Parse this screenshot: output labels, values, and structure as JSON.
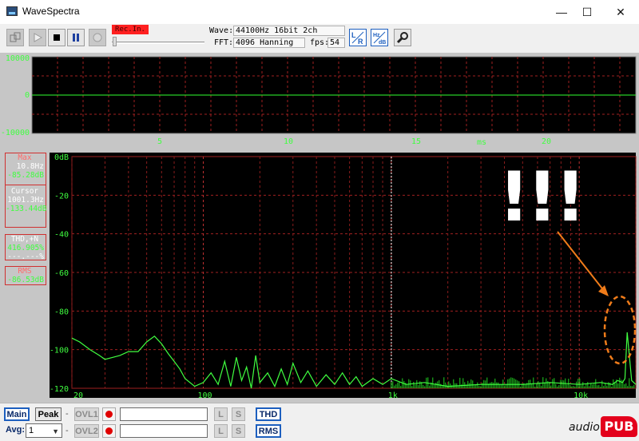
{
  "window": {
    "title": "WaveSpectra",
    "minimize": "—",
    "maximize": "☐",
    "close": "✕"
  },
  "toolbar": {
    "rec_in": "Rec.In.",
    "wave_label": "Wave:",
    "wave_value": "44100Hz 16bit 2ch",
    "fft_label": "FFT:",
    "fft_value": "4096 Hanning",
    "fps_label": "fps:",
    "fps_value": "54",
    "icons": [
      "mixer-icon",
      "play-icon",
      "stop-icon",
      "pause-icon",
      "record-icon",
      "lr-channel-icon",
      "hz-db-icon",
      "wrench-icon"
    ]
  },
  "wave_display": {
    "y_ticks": [
      "10000",
      "0",
      "-10000"
    ],
    "x_ticks": [
      "5",
      "10",
      "15",
      "20"
    ],
    "x_unit": "ms"
  },
  "spectrum": {
    "y_ticks": [
      "0dB",
      "-20",
      "-40",
      "-60",
      "-80",
      "-100",
      "-120"
    ],
    "x_ticks": [
      "20",
      "100",
      "1k",
      "10k"
    ],
    "max": {
      "label": "Max",
      "freq": "10.8Hz",
      "level": "-85.28dB"
    },
    "cursor": {
      "label": "Cursor",
      "freq": "1001.3Hz",
      "level": "-133.44dB"
    },
    "thd": {
      "label": "THD,+N",
      "value": "416.905%",
      "unit_top": "%",
      "value2": "---.---",
      "unit_bottom": "%"
    },
    "rms": {
      "label": "RMS",
      "value": "-86.53dB"
    },
    "annotation": "!!!"
  },
  "chart_data": {
    "type": "line",
    "x_scale": "log",
    "xlim": [
      20,
      20000
    ],
    "ylim": [
      -120,
      0
    ],
    "ylabel": "dB",
    "grid": true,
    "cursor_x": 1001.3,
    "series": [
      {
        "x": [
          20,
          22,
          25,
          28,
          30,
          33,
          36,
          40,
          45,
          50,
          55,
          60,
          65,
          70,
          75,
          80,
          90,
          100,
          110,
          120,
          130,
          140,
          150,
          160,
          170,
          180,
          190,
          200,
          220,
          240,
          260,
          280,
          300,
          330,
          360,
          400,
          450,
          500,
          550,
          600,
          650,
          700,
          800,
          900,
          1000,
          1200,
          1500,
          2000,
          3000,
          5000,
          7000,
          10000,
          13000,
          15000,
          16000,
          17000,
          17500,
          18000,
          19000,
          20000
        ],
        "y": [
          -94,
          -96,
          -100,
          -103,
          -105,
          -104,
          -103,
          -101,
          -101,
          -96,
          -93,
          -97,
          -102,
          -106,
          -110,
          -115,
          -119,
          -117,
          -112,
          -118,
          -106,
          -119,
          -104,
          -116,
          -109,
          -120,
          -103,
          -117,
          -112,
          -119,
          -110,
          -118,
          -107,
          -117,
          -111,
          -119,
          -113,
          -118,
          -112,
          -118,
          -114,
          -119,
          -115,
          -118,
          -115,
          -118,
          -117,
          -119,
          -118,
          -118,
          -117,
          -118,
          -117,
          -118,
          -116,
          -117,
          -115,
          -91,
          -116,
          -118
        ]
      }
    ]
  },
  "bottom": {
    "main": "Main",
    "peak": "Peak",
    "ovl1": "OVL1",
    "ovl2": "OVL2",
    "avg_label": "Avg:",
    "avg_value": "1",
    "dash": "-",
    "l": "L",
    "s": "S",
    "thd": "THD",
    "rms": "RMS",
    "logo_audio": "audio",
    "logo_pub": "PUB"
  }
}
